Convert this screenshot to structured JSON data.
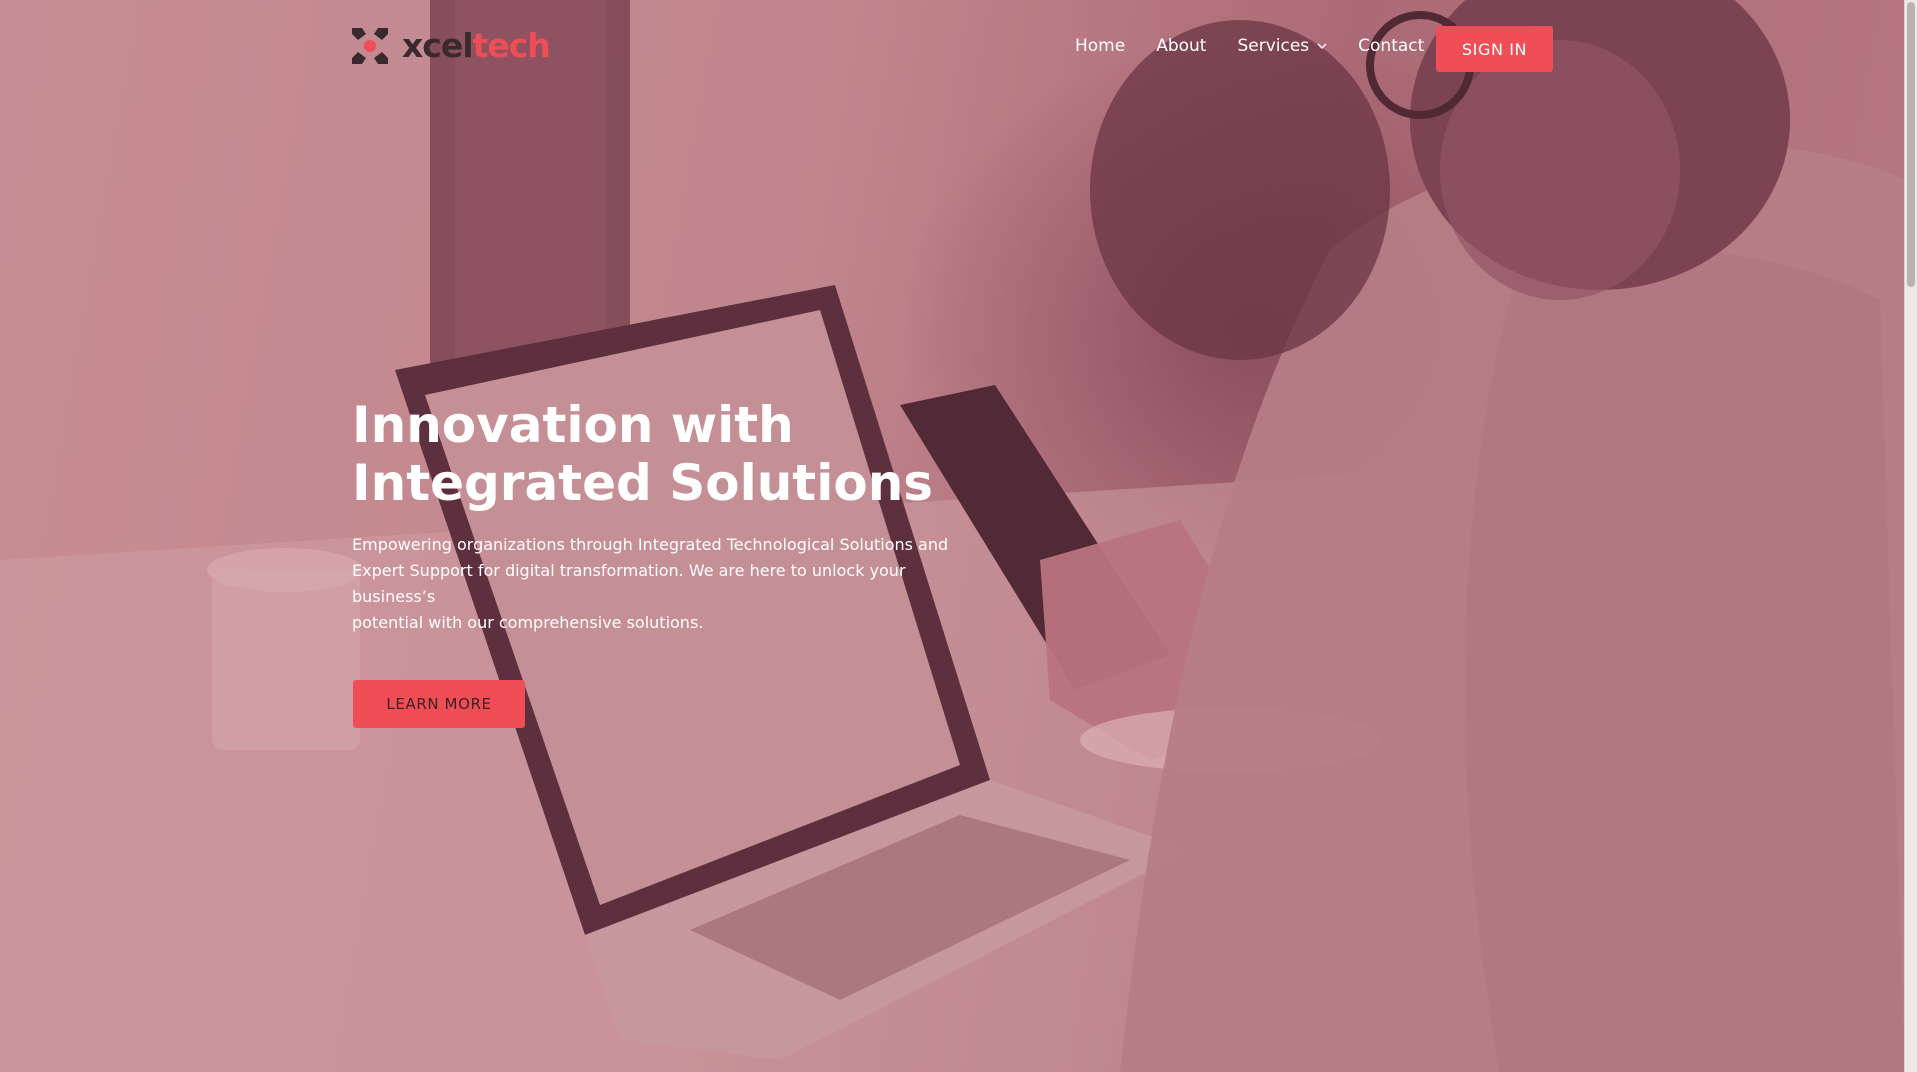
{
  "brand": {
    "name_part1": "xcel",
    "name_part2": "tech",
    "accent_color": "#ef4e57",
    "logo_icon": "x-dot-logo-icon"
  },
  "nav": {
    "items": [
      {
        "label": "Home"
      },
      {
        "label": "About"
      },
      {
        "label": "Services",
        "icon": "chevron-down-icon"
      },
      {
        "label": "Contact"
      }
    ],
    "signin_label": "SIGN IN"
  },
  "hero": {
    "headline_line1": "Innovation with",
    "headline_line2": "Integrated Solutions",
    "lede_line1": "Empowering organizations through Integrated Technological Solutions and",
    "lede_line2": "Expert Support for digital transformation. We are here to unlock your business’s",
    "lede_line3": "potential with our comprehensive solutions.",
    "cta_label": "LEARN MORE",
    "background_tint": "#c28a90"
  }
}
